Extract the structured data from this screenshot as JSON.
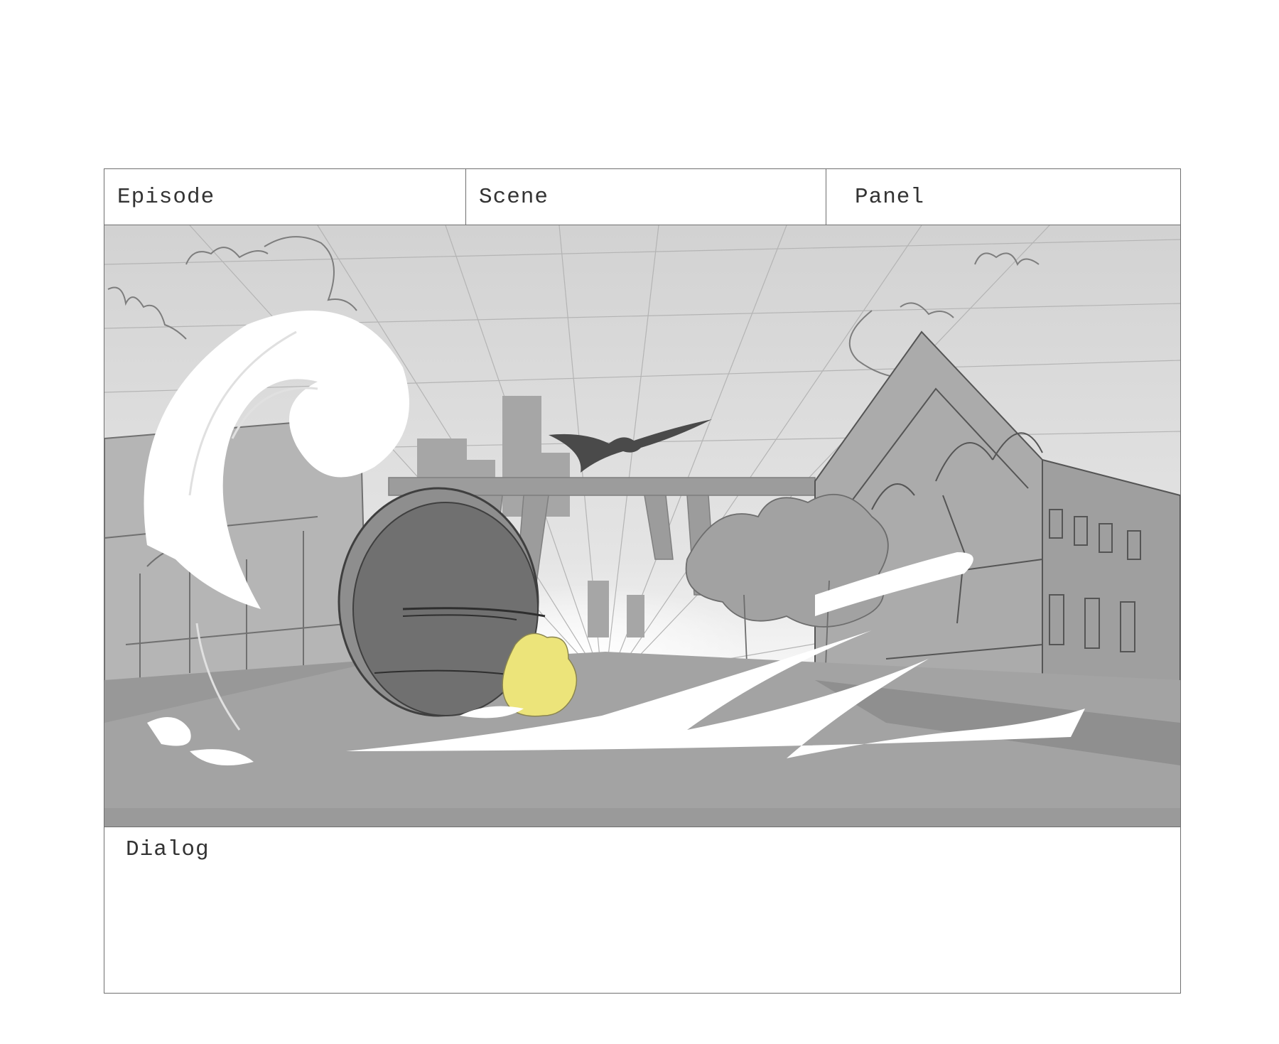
{
  "header": {
    "episode_label": "Episode",
    "scene_label": "Scene",
    "panel_label": "Panel"
  },
  "dialog": {
    "label": "Dialog"
  },
  "colors": {
    "border": "#6f6f6f",
    "sky": "#dedede",
    "ground": "#9a9a9a",
    "splash": "#ffffff",
    "character": "#ece47a",
    "wheel": "#6e6e6e"
  }
}
